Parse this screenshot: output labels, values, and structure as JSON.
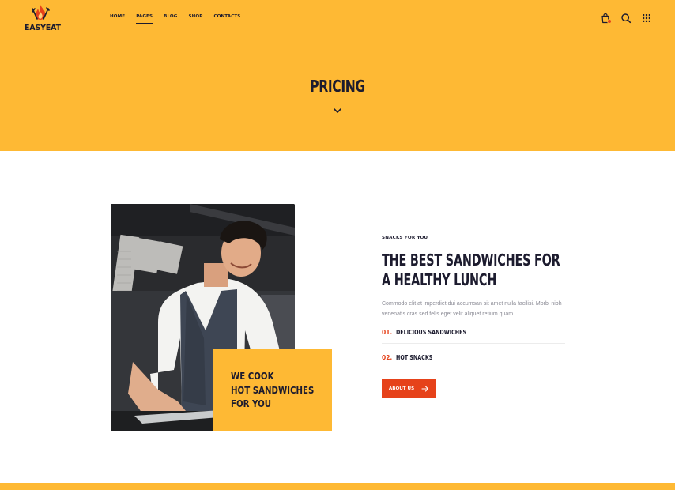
{
  "brand": {
    "name": "EASYEAT",
    "accent": "#feb934",
    "cta": "#e6421a",
    "text": "#1c1b2e"
  },
  "nav": {
    "items": [
      {
        "label": "Home"
      },
      {
        "label": "Pages"
      },
      {
        "label": "Blog"
      },
      {
        "label": "Shop"
      },
      {
        "label": "Contacts"
      }
    ],
    "active": "Pages"
  },
  "header_icons": [
    "shopping-bag-icon",
    "search-icon",
    "grid-menu-icon"
  ],
  "hero": {
    "title": "PRICING",
    "icon": "chevron-down-icon"
  },
  "promo": {
    "text": "WE COOK\nHOT SANDWICHES\nFOR YOU"
  },
  "content": {
    "eyebrow": "Snacks for you",
    "heading": "THE BEST SANDWICHES FOR A HEALTHY LUNCH",
    "paragraph": "Commodo elit at imperdiet dui accumsan sit amet nulla facilisi. Morbi nibh venenatis cras sed felis eget velit aliquet retium quam.",
    "list": [
      {
        "num": "01.",
        "label": "DELICIOUS SANDWICHES"
      },
      {
        "num": "02.",
        "label": "HOT SNACKS"
      }
    ],
    "button_label": "About us",
    "button_icon": "arrow-right-icon"
  }
}
